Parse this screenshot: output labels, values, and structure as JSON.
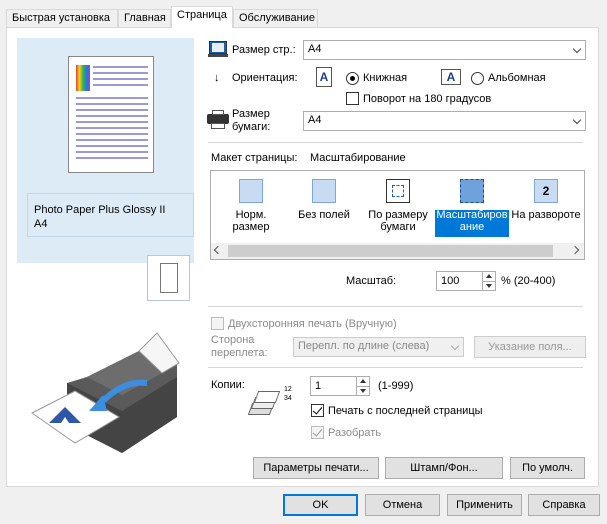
{
  "tabs": [
    "Быстрая установка",
    "Главная",
    "Страница",
    "Обслуживание"
  ],
  "active_tab": "Страница",
  "preview": {
    "media_line1": "Photo Paper Plus Glossy II",
    "media_line2": "A4"
  },
  "page_size": {
    "label": "Размер стр.:",
    "value": "A4"
  },
  "orientation": {
    "label": "Ориентация:",
    "portrait": "Книжная",
    "landscape": "Альбомная",
    "selected": "portrait",
    "rotate_label": "Поворот на 180 градусов",
    "rotate_checked": false
  },
  "paper_size": {
    "label_line1": "Размер",
    "label_line2": "бумаги:",
    "value": "A4"
  },
  "layout": {
    "label": "Макет страницы:",
    "current": "Масштабирование",
    "items": [
      {
        "line1": "Норм.",
        "line2": "размер",
        "icon": "normal-size-icon"
      },
      {
        "line1": "Без полей",
        "line2": "",
        "icon": "borderless-icon"
      },
      {
        "line1": "По размеру",
        "line2": "бумаги",
        "icon": "fit-to-page-icon"
      },
      {
        "line1": "Масштабиров",
        "line2": "ание",
        "icon": "scaled-icon"
      },
      {
        "line1": "На развороте",
        "line2": "",
        "icon": "page-layout-icon"
      }
    ],
    "selected_index": 3,
    "page_layout_number": "2"
  },
  "scale": {
    "label": "Масштаб:",
    "value": "100",
    "range": "% (20-400)"
  },
  "duplex": {
    "label": "Двухсторонняя печать (Вручную)",
    "side_label_line1": "Сторона",
    "side_label_line2": "переплета:",
    "side_value": "Перепл. по длине (слева)",
    "margin_button": "Указание поля..."
  },
  "copies": {
    "label": "Копии:",
    "value": "1",
    "range": "(1-999)",
    "last_page_first": "Печать с последней страницы",
    "last_page_first_checked": true,
    "collate": "Разобрать",
    "collate_checked": true,
    "stack_digits": "1234"
  },
  "buttons": {
    "print_options": "Параметры печати...",
    "stamp": "Штамп/Фон...",
    "defaults": "По умолч."
  },
  "dialog": {
    "ok": "OK",
    "cancel": "Отмена",
    "apply": "Применить",
    "help": "Справка"
  },
  "colors": {
    "selection": "#0078d7",
    "layout_icon": "#c7dbf3",
    "printer_body": "#4b4b4b"
  }
}
